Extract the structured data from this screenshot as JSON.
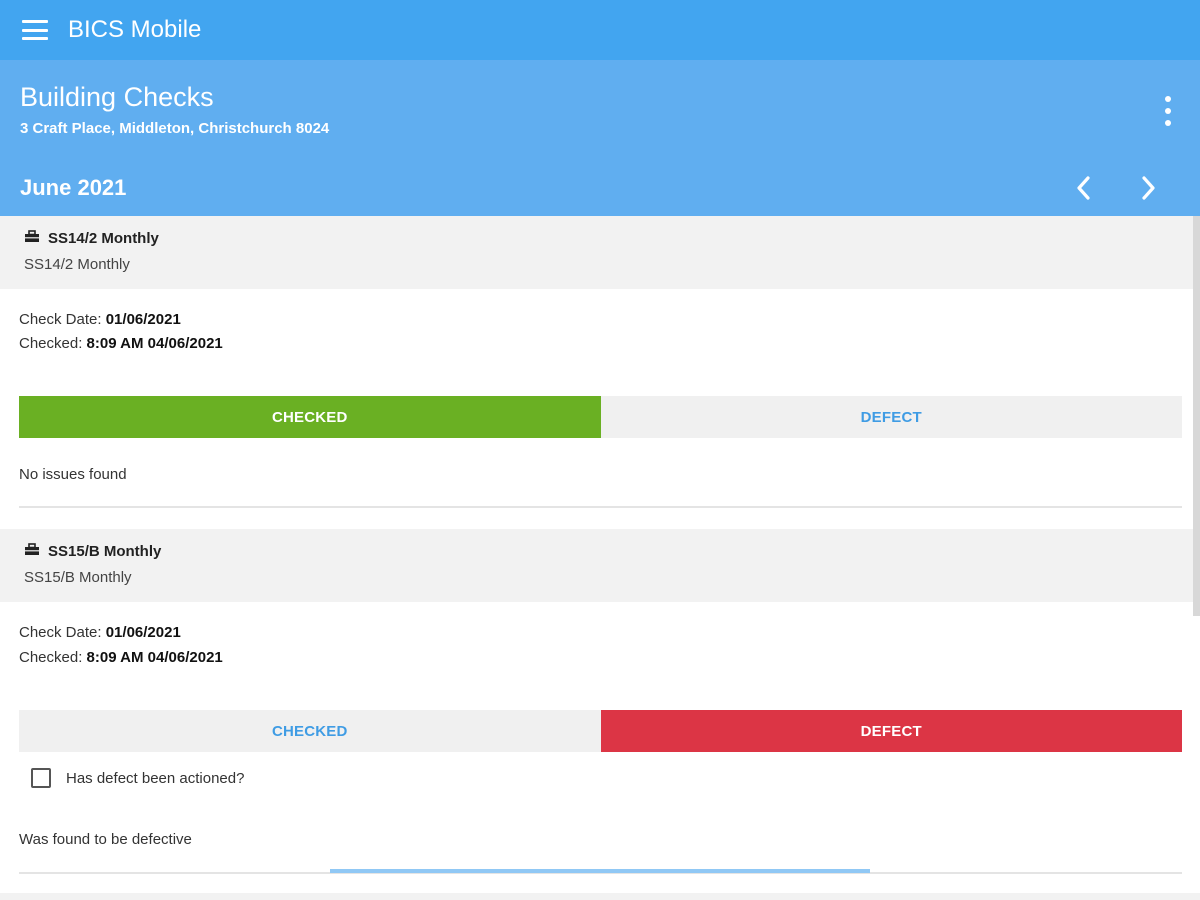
{
  "app": {
    "title": "BICS Mobile"
  },
  "header": {
    "title": "Building Checks",
    "subtitle": "3 Craft Place, Middleton, Christchurch 8024",
    "month": "June 2021"
  },
  "icons": {
    "menu": "menu-icon",
    "more": "more-vertical-icon",
    "prev": "chevron-left-icon",
    "next": "chevron-right-icon",
    "item": "toolbox-icon"
  },
  "colors": {
    "appbar": "#42a5f0",
    "header": "#60aef0",
    "checked_active": "#6ab023",
    "defect_active": "#dc3545",
    "inactive_text": "#3f9ce4"
  },
  "checks": [
    {
      "title": "SS14/2 Monthly",
      "subtitle": "SS14/2 Monthly",
      "check_date_label": "Check Date:",
      "check_date": "01/06/2021",
      "checked_label": "Checked:",
      "checked": "8:09 AM 04/06/2021",
      "checked_btn": "CHECKED",
      "defect_btn": "DEFECT",
      "status": "CHECKED",
      "note": "No issues found"
    },
    {
      "title": "SS15/B Monthly",
      "subtitle": "SS15/B Monthly",
      "check_date_label": "Check Date:",
      "check_date": "01/06/2021",
      "checked_label": "Checked:",
      "checked": "8:09 AM 04/06/2021",
      "checked_btn": "CHECKED",
      "defect_btn": "DEFECT",
      "status": "DEFECT",
      "actioned_label": "Has defect been actioned?",
      "actioned": false,
      "note": "Was found to be defective"
    }
  ]
}
